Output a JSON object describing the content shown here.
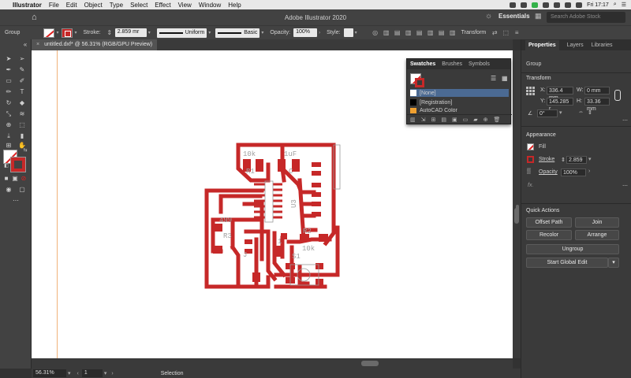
{
  "menubar": {
    "app": "Illustrator",
    "items": [
      "File",
      "Edit",
      "Object",
      "Type",
      "Select",
      "Effect",
      "View",
      "Window",
      "Help"
    ],
    "clock": "Fri 17:17"
  },
  "appbar": {
    "title": "Adobe Illustrator 2020",
    "workspace": "Essentials",
    "search_placeholder": "Search Adobe Stock"
  },
  "controlbar": {
    "selection_type": "Group",
    "stroke_label": "Stroke:",
    "stroke_weight": "2.859 mr",
    "profile": "Uniform",
    "brush": "Basic",
    "opacity_label": "Opacity:",
    "opacity": "100%",
    "style_label": "Style:",
    "transform_label": "Transform"
  },
  "document": {
    "tab_title": "untitled.dxf* @ 56.31% (RGB/GPU Preview)"
  },
  "pcb_labels": {
    "r1_value": "10k",
    "r1_name": "R1",
    "c1_value": "1uF",
    "c1_name": "C",
    "r3_value": "499",
    "r3_name": "R3",
    "r2_name": "R2",
    "r2_value": "10k",
    "s1_name": "S1",
    "u1_name": "U3",
    "x1_name": "1",
    "j_name": "J"
  },
  "swatches": {
    "tabs": [
      "Swatches",
      "Brushes",
      "Symbols"
    ],
    "rows": [
      {
        "name": "[None]",
        "color": "#ffffff"
      },
      {
        "name": "[Registration]",
        "color": "#000000"
      },
      {
        "name": "AutoCAD Color",
        "color": "#f0a030"
      }
    ]
  },
  "properties": {
    "tabs": [
      "Properties",
      "Layers",
      "Libraries"
    ],
    "selection": "Group",
    "transform_title": "Transform",
    "x_label": "X:",
    "x": "336.4 mm",
    "y_label": "Y:",
    "y": "145.285 r",
    "w_label": "W:",
    "w": "0 mm",
    "h_label": "H:",
    "h": "33.36 mm",
    "angle": "0°",
    "appearance_title": "Appearance",
    "fill_label": "Fill",
    "stroke_label": "Stroke",
    "stroke_weight": "2.859",
    "opacity_label": "Opacity",
    "opacity": "100%",
    "fx_label": "fx.",
    "quick_actions_title": "Quick Actions",
    "buttons": {
      "offset_path": "Offset Path",
      "join": "Join",
      "recolor": "Recolor",
      "arrange": "Arrange",
      "ungroup": "Ungroup",
      "start_global_edit": "Start Global Edit"
    }
  },
  "status": {
    "zoom": "56.31%",
    "page": "1",
    "tool": "Selection"
  },
  "colors": {
    "trace": "#c62828",
    "accent": "#4b6a93"
  }
}
